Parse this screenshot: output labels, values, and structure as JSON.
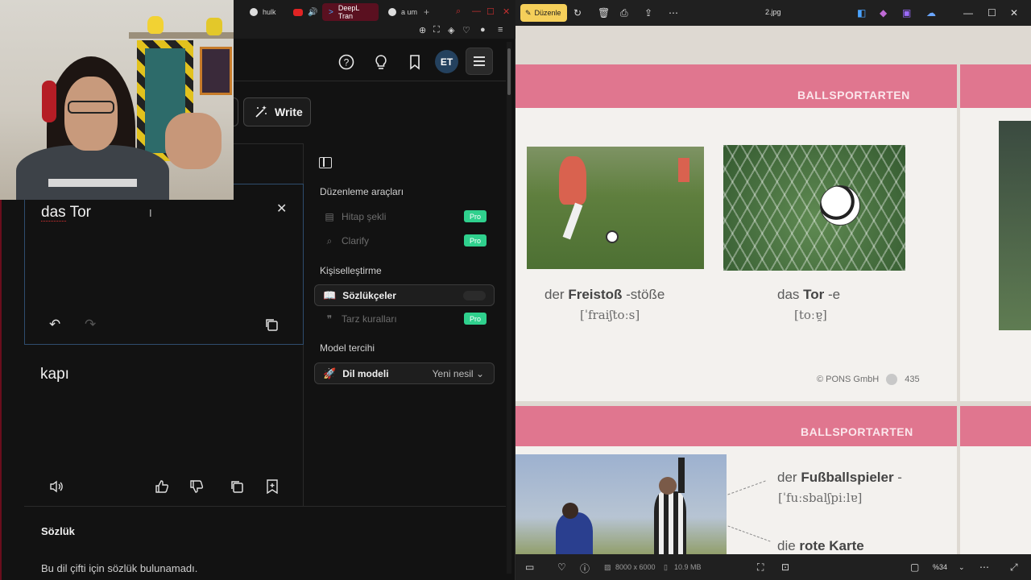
{
  "browser": {
    "tabs": [
      {
        "label": "hulk"
      },
      {
        "label": "DeepL Tran"
      },
      {
        "label": "a um"
      }
    ]
  },
  "deepl": {
    "header": {
      "avatar_initials": "ET"
    },
    "write_label": "Write",
    "source_text_1": "das",
    "source_text_2": "Tor",
    "target_text": "kapı",
    "panel": {
      "section_editing": "Düzenleme araçları",
      "tool_tone": "Hitap şekli",
      "tool_clarify": "Clarify",
      "pro_label": "Pro",
      "section_personal": "Kişiselleştirme",
      "glossary": "Sözlükçeler",
      "style_rules": "Tarz kuralları",
      "section_model": "Model tercihi",
      "model_label": "Dil modeli",
      "model_value": "Yeni nesil"
    },
    "dictionary": {
      "title": "Sözlük",
      "message": "Bu dil çifti için sözlük bulunamadı."
    }
  },
  "viewer": {
    "edit_label": "Düzenle",
    "file_name": "2.jpg",
    "dimensions": "8000 x 6000",
    "file_size": "10.9 MB",
    "zoom": "%34",
    "card1": {
      "band": "BALLSPORTARTEN",
      "word1_article": "der",
      "word1_noun": "Freistoß",
      "word1_plural": "-stöße",
      "word1_ipa": "[ˈfraiʃtoːs]",
      "word2_article": "das",
      "word2_noun": "Tor",
      "word2_plural": "-e",
      "word2_ipa": "[toːɐ̯]",
      "copyright": "© PONS GmbH",
      "page": "435"
    },
    "card2": {
      "band": "BALLSPORTARTEN",
      "word1_article": "der",
      "word1_noun": "Fußballspieler",
      "word1_plural": "-",
      "word1_ipa": "[ˈfuːsbalʃpiːlɐ]",
      "word2_article": "die",
      "word2_noun": "rote Karte"
    }
  }
}
